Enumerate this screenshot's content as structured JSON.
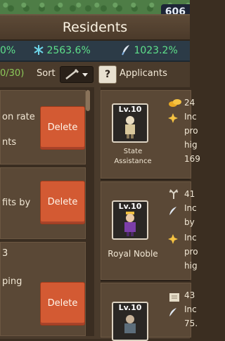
{
  "top_bar": {
    "count_partial": "606"
  },
  "window": {
    "title": "Residents"
  },
  "stats": [
    {
      "icon": "gear-icon",
      "value": "0%"
    },
    {
      "icon": "snowflake-icon",
      "value": "2563.6%"
    },
    {
      "icon": "quill-icon",
      "value": "1023.2%"
    }
  ],
  "controls": {
    "resident_count": "0/30)",
    "sort_label": "Sort",
    "help_label": "?",
    "applicants_label": "Applicants"
  },
  "residents": [
    {
      "lines": [
        "on rate",
        "",
        "nts"
      ],
      "delete_label": "Delete"
    },
    {
      "lines": [
        "fits by"
      ],
      "delete_label": "Delete"
    },
    {
      "lines": [
        "3",
        "",
        "ping"
      ],
      "delete_label": "Delete"
    }
  ],
  "applicants": [
    {
      "level": "Lv.10",
      "role": "State\nAssistance",
      "lines": [
        "24",
        "Inc",
        "pro",
        "hig",
        "169"
      ]
    },
    {
      "level": "Lv.10",
      "role": "Royal Noble",
      "lines": [
        "41",
        "Inc",
        "by",
        "Inc",
        "pro",
        "hig"
      ]
    },
    {
      "level": "Lv.10",
      "role": "",
      "lines": [
        "43",
        "Inc",
        "75."
      ]
    }
  ]
}
